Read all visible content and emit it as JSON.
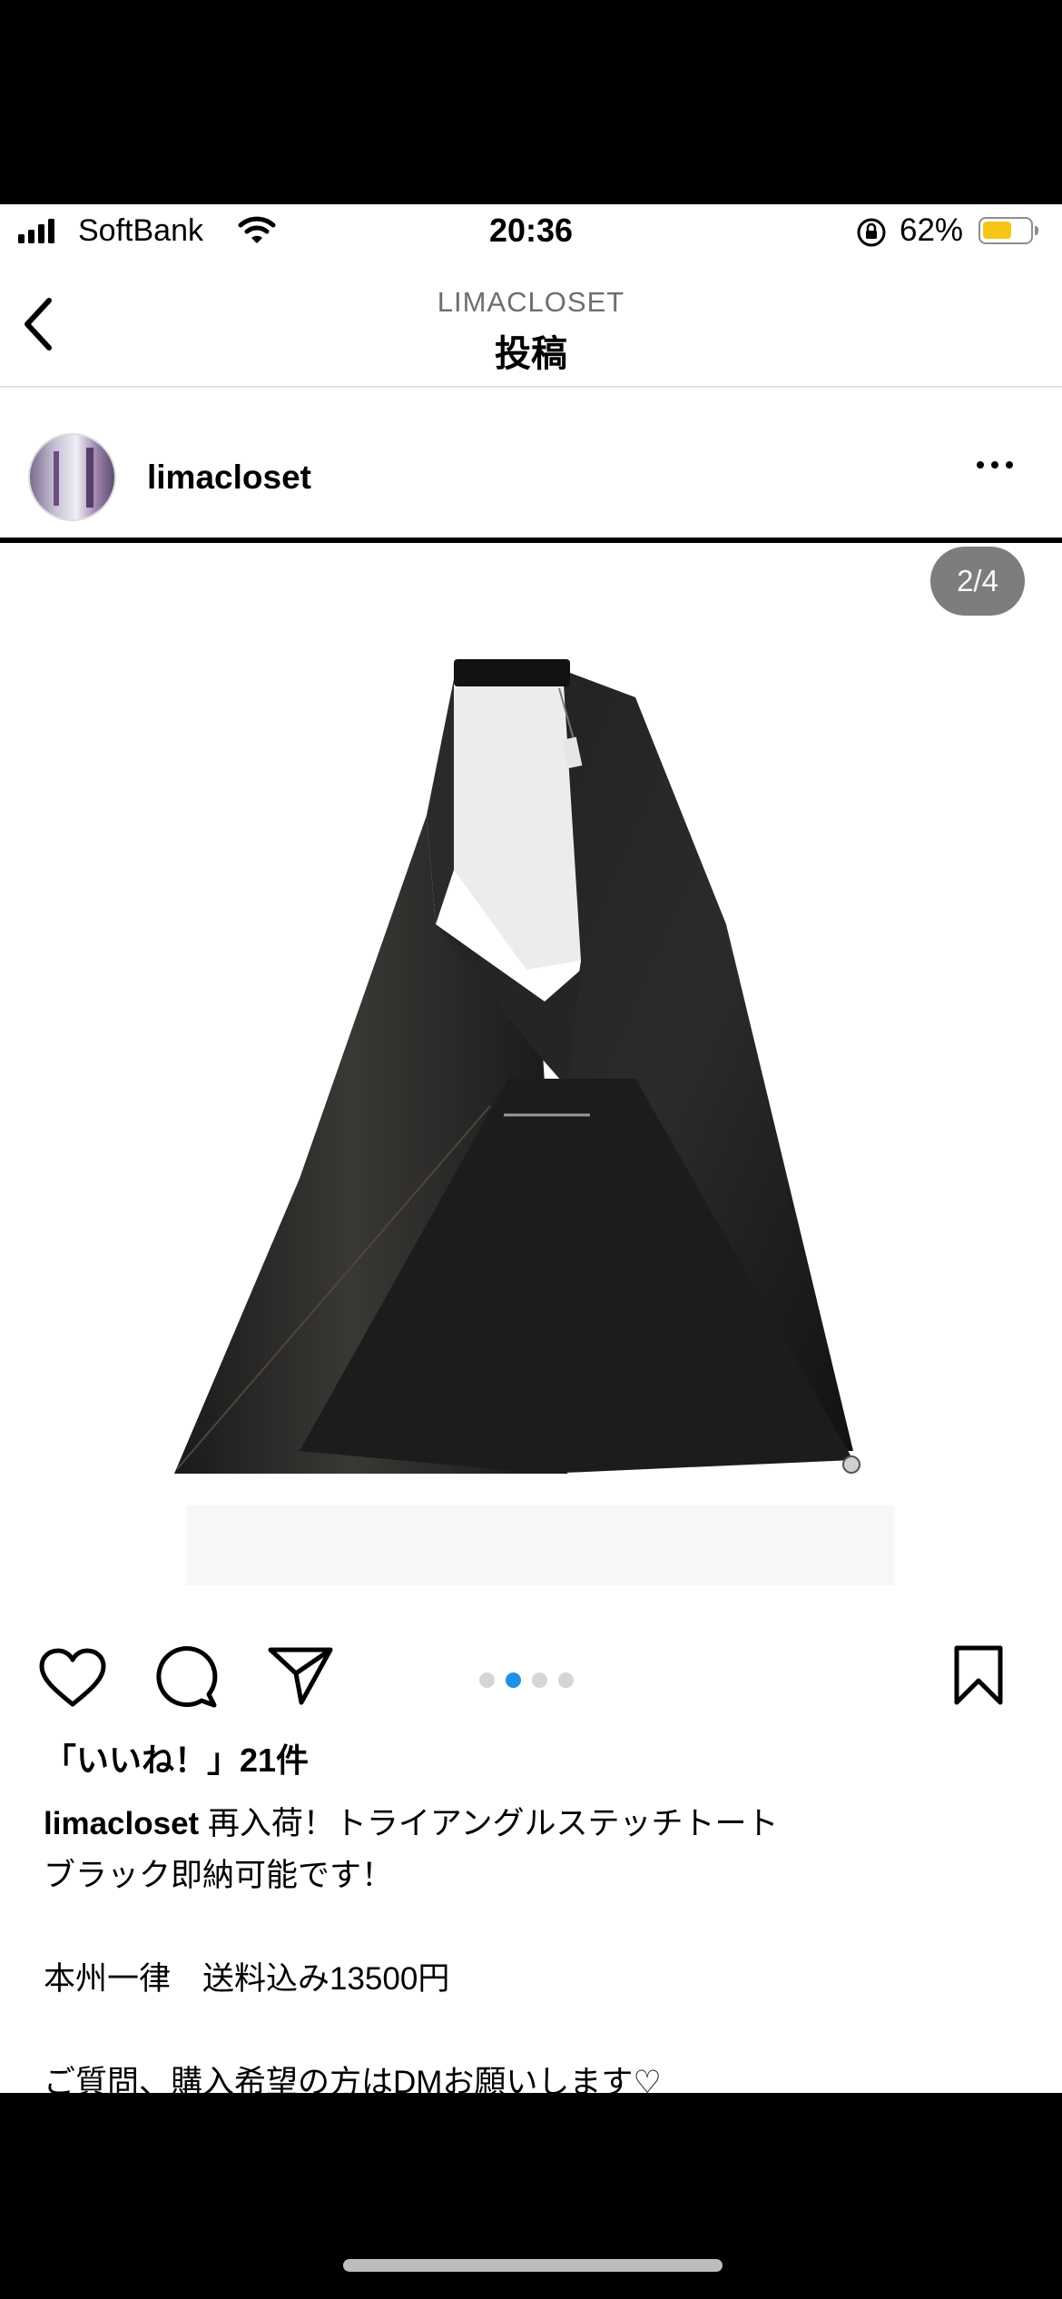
{
  "status_bar": {
    "carrier": "SoftBank",
    "time": "20:36",
    "battery_percent": "62%",
    "battery_level": 0.62,
    "battery_color": "#f5c518"
  },
  "nav": {
    "account": "LIMACLOSET",
    "title": "投稿",
    "back_icon": "chevron-left-icon"
  },
  "post": {
    "username": "limacloset",
    "more_icon": "more-horizontal-icon",
    "media_counter": "2/4",
    "carousel": {
      "count": 4,
      "active_index": 1,
      "active_color": "#1e90e8"
    },
    "likes": "「いいね！」21件",
    "caption": {
      "username": "limacloset",
      "line1": " 再入荷！トライアングルステッチトート",
      "line2": "ブラック即納可能です！",
      "line3": "",
      "line4": "本州一律　送料込み13500円",
      "line5": "",
      "line6": "ご質問、購入希望の方はDMお願いします♡"
    }
  },
  "icons": [
    "heart-icon",
    "comment-icon",
    "share-icon",
    "bookmark-icon"
  ]
}
